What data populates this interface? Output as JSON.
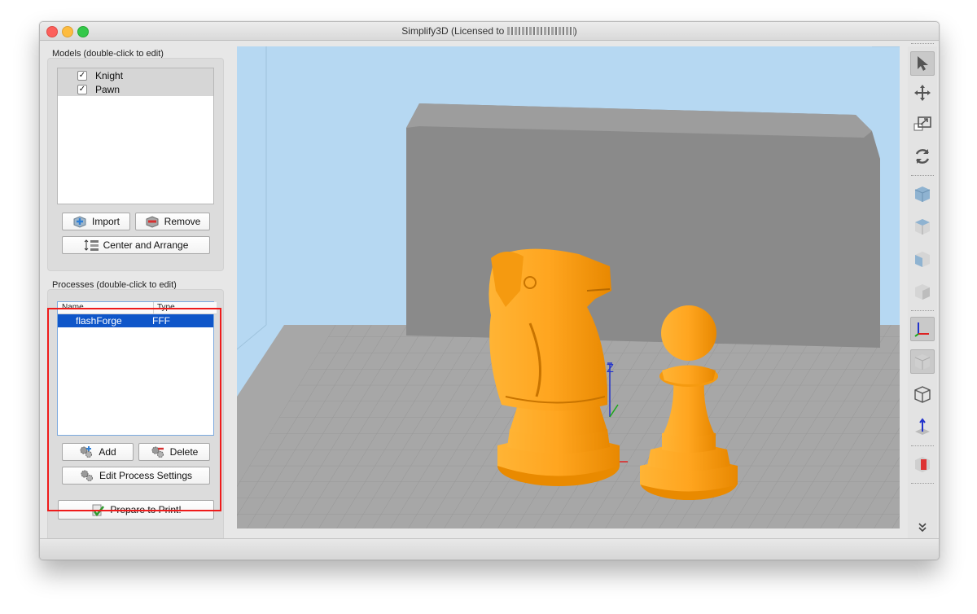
{
  "window": {
    "title": "Simplify3D (Licensed to ",
    "title_suffix": ")"
  },
  "models": {
    "group_title": "Models (double-click to edit)",
    "items": [
      {
        "label": "Knight",
        "checked": true
      },
      {
        "label": "Pawn",
        "checked": true
      }
    ],
    "import_label": "Import",
    "remove_label": "Remove",
    "center_label": "Center and Arrange"
  },
  "processes": {
    "group_title": "Processes (double-click to edit)",
    "columns": [
      "Name",
      "Type"
    ],
    "rows": [
      {
        "name": "flashForge",
        "type": "FFF",
        "selected": true
      }
    ],
    "add_label": "Add",
    "delete_label": "Delete",
    "edit_label": "Edit Process Settings"
  },
  "prepare_label": "Prepare to Print!",
  "colors": {
    "highlight": "#ef1b1b",
    "selection": "#0f56c9",
    "model": "#ffa51f",
    "viewport_bg": "#b6d8f2"
  },
  "toolbar": {
    "icons": [
      "select-arrow-icon",
      "move-icon",
      "scale-icon",
      "rotate-icon",
      "view-default-icon",
      "view-front-icon",
      "view-top-icon",
      "view-side-icon",
      "axes-icon",
      "solid-view-icon",
      "wireframe-view-icon",
      "normal-view-icon",
      "cross-section-icon",
      "expand-icon"
    ]
  }
}
